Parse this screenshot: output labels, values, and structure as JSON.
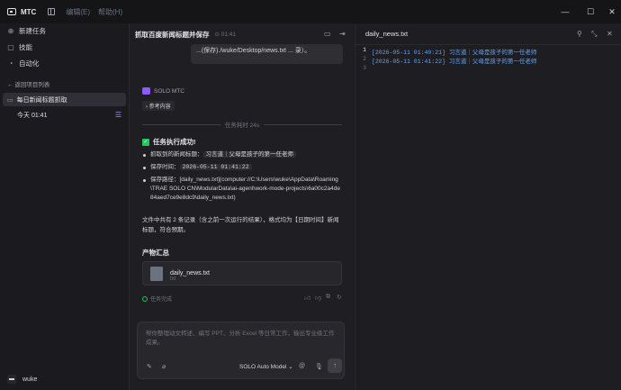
{
  "app": {
    "name": "MTC",
    "menus": [
      "编辑(E)",
      "帮助(H)"
    ]
  },
  "sidebar": {
    "items": [
      {
        "label": "新建任务",
        "icon": "new-task-icon"
      },
      {
        "label": "技能",
        "icon": "skill-icon"
      },
      {
        "label": "自动化",
        "icon": "automation-icon"
      }
    ],
    "back_label": "返回项目列表",
    "project": "每日新闻标题抓取",
    "session": "今天 01:41",
    "user": "wuke"
  },
  "chat": {
    "title": "抓取百度新闻标题并保存",
    "time": "01:41",
    "bubble_text": "...(保存)./wuke/Desktop/news.txt ... 录）。",
    "agent_name": "SOLO MTC",
    "ref_label": "参考内容",
    "divider": "任务耗时 24s",
    "success_title": "任务执行成功!",
    "bullets": [
      {
        "label": "抓取到的新闻标题：",
        "value": "习言道｜父母是孩子的第一任老师"
      },
      {
        "label": "保存时间：",
        "code": "2026-05-11 01:41:22"
      },
      {
        "label": "保存路径：",
        "value": "[daily_news.txt](computer://C:\\Users\\wuke\\AppData\\Roaming\\TRAE SOLO CN\\ModularData\\ai-agent\\work-mode-projects\\6a00c2a4de84aed7ce9e8dc9\\daily_news.txt)"
      }
    ],
    "summary": "文件中共有 2 条记录（含之前一次运行的结果），格式均为【日期时间】新闻标题，符合预期。",
    "artifacts_title": "产物汇总",
    "artifact": {
      "name": "daily_news.txt",
      "ext": "txt"
    },
    "status": "任务完成",
    "input_placeholder": "帮你整理动文转述、编写 PPT、分析 Excel 等日常工作，输出专业级工作成果。",
    "model": "SOLO Auto Model"
  },
  "editor": {
    "filename": "daily_news.txt",
    "lines": [
      {
        "num": "1",
        "text": "[2026-05-11 01:40:21] 习言道｜父母是孩子的第一任老师"
      },
      {
        "num": "2",
        "text": "[2026-05-11 01:41:22] 习言道｜父母是孩子的第一任老师"
      },
      {
        "num": "3",
        "text": ""
      }
    ]
  },
  "colors": {
    "accent": "#8b5cf6",
    "success": "#22c55e",
    "code_text": "#60a5fa"
  }
}
